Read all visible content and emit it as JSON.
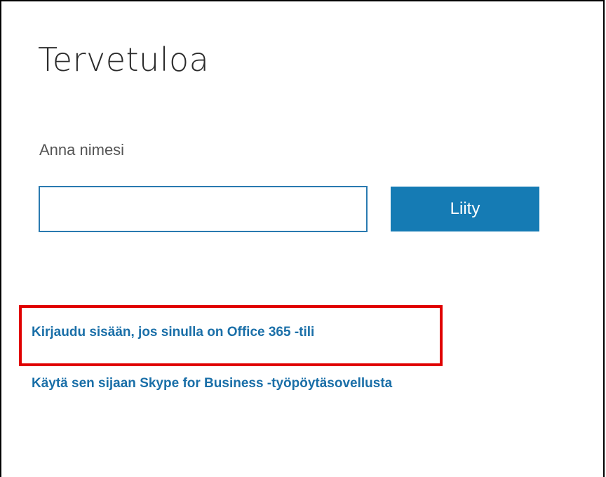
{
  "page": {
    "title": "Tervetuloa",
    "name_label": "Anna nimesi",
    "name_input": {
      "value": "",
      "placeholder": ""
    },
    "join_button_label": "Liity",
    "links": {
      "signin_office365": "Kirjaudu sisään, jos sinulla on Office 365 -tili",
      "use_desktop_app": "Käytä sen sijaan Skype for Business -työpöytäsovellusta"
    }
  },
  "colors": {
    "accent": "#157bb4",
    "link": "#1a6fa8",
    "input_border": "#2a7ab0",
    "highlight": "#e00000"
  }
}
